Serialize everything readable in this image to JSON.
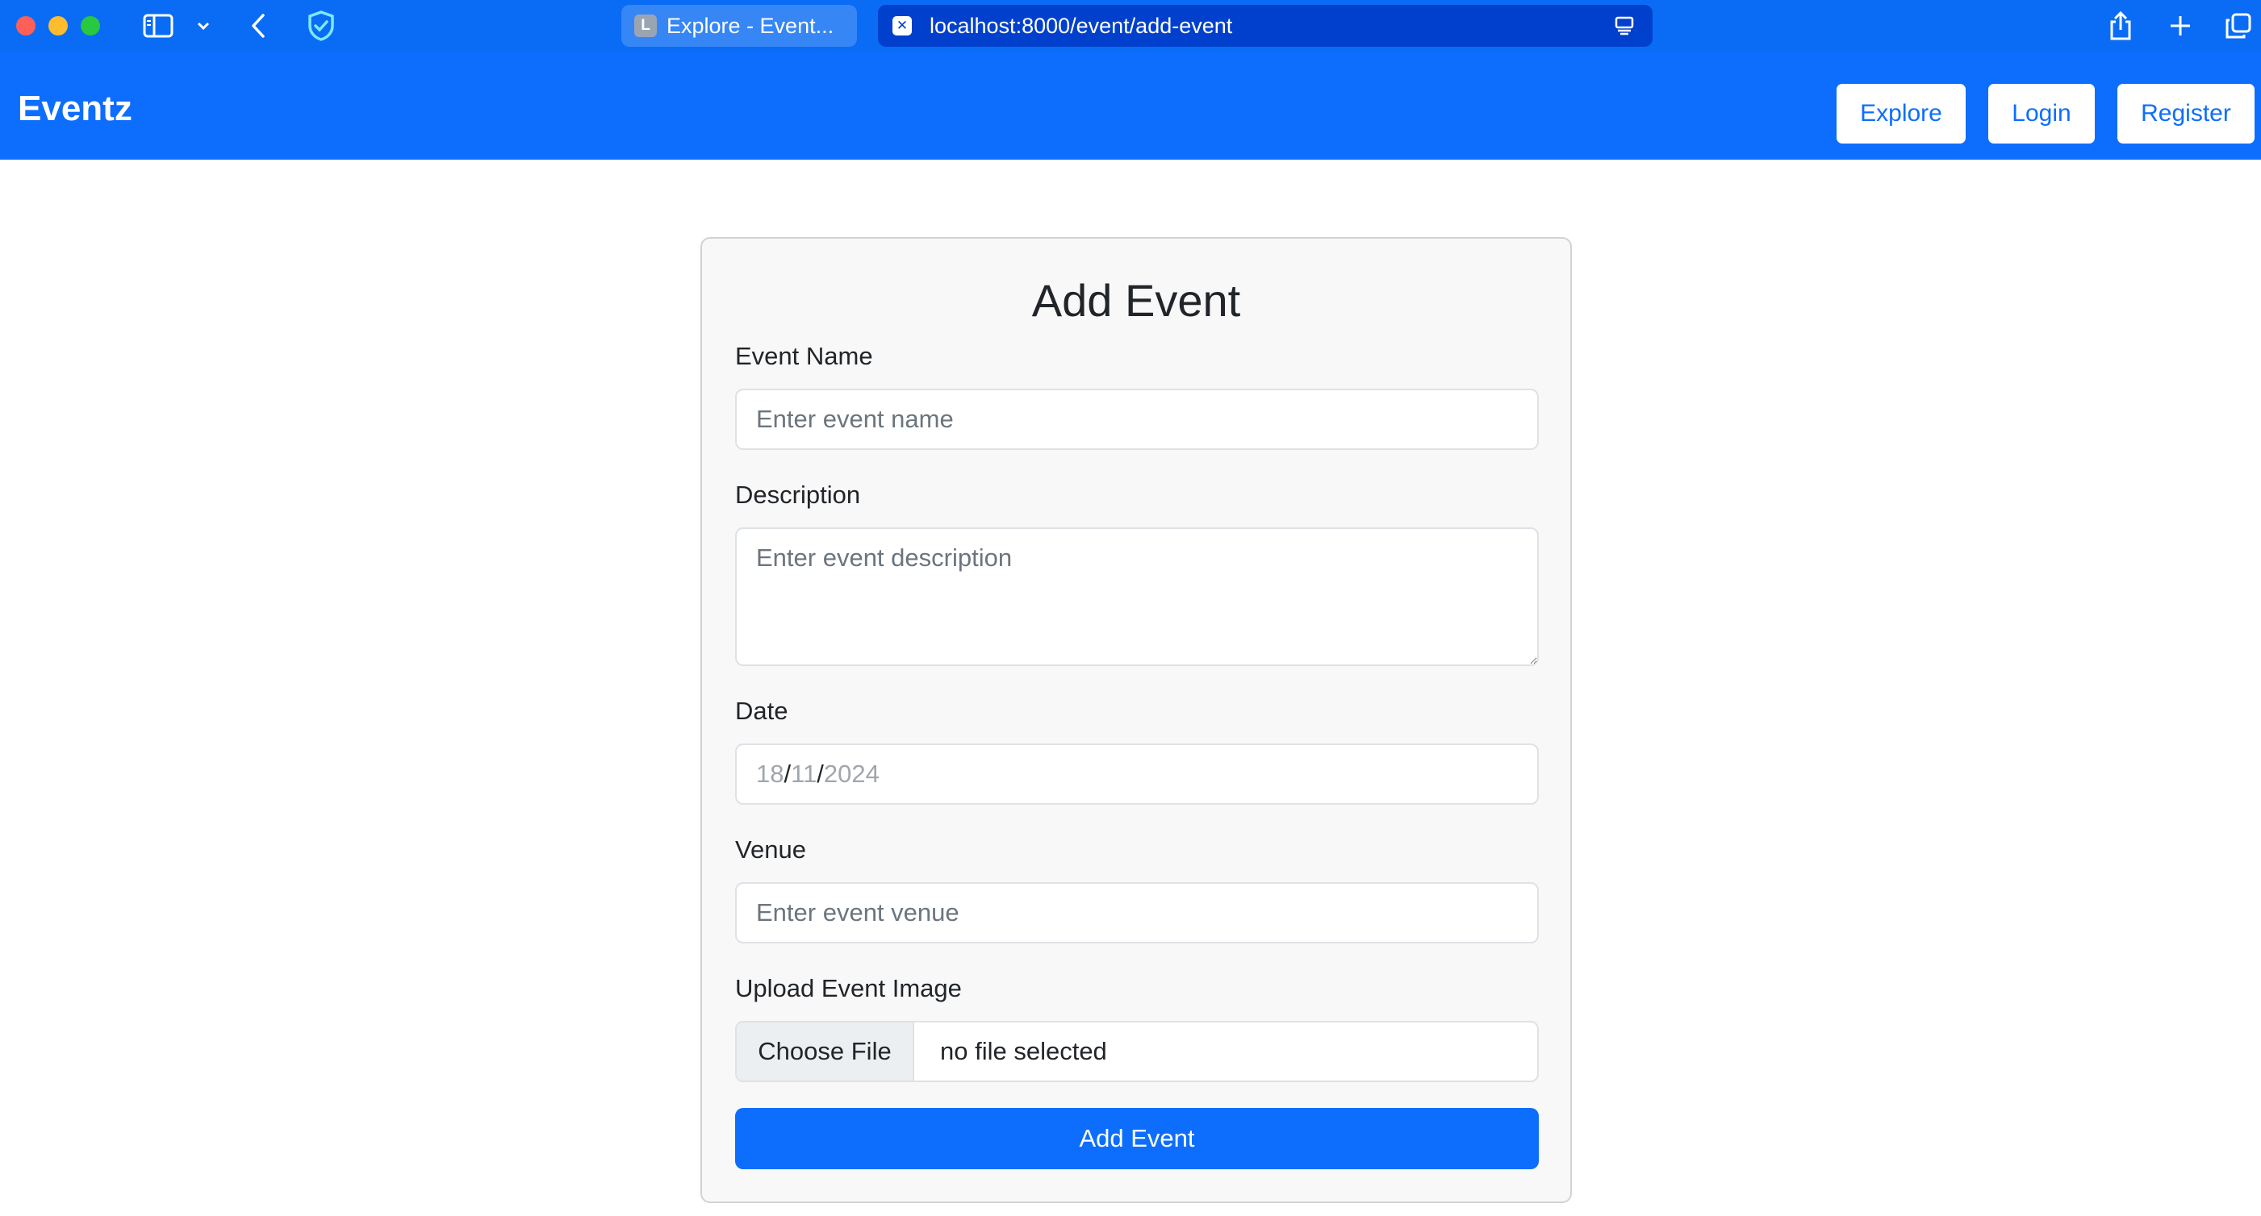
{
  "browser": {
    "tabs": [
      {
        "favicon": "L",
        "title": "Explore - Event..."
      }
    ],
    "url": "localhost:8000/event/add-event",
    "icons": [
      "sidebar-icon",
      "chevron-down-icon",
      "back-icon",
      "shield-icon",
      "reader-icon",
      "share-icon",
      "plus-icon",
      "tabs-overview-icon"
    ]
  },
  "navbar": {
    "brand": "Eventz",
    "links": [
      "Explore",
      "Login",
      "Register"
    ]
  },
  "form": {
    "title": "Add Event",
    "event_name": {
      "label": "Event Name",
      "placeholder": "Enter event name",
      "value": ""
    },
    "description": {
      "label": "Description",
      "placeholder": "Enter event description",
      "value": ""
    },
    "date": {
      "label": "Date",
      "day": "18",
      "month": "11",
      "year": "2024",
      "separator": "/"
    },
    "venue": {
      "label": "Venue",
      "placeholder": "Enter event venue",
      "value": ""
    },
    "image": {
      "label": "Upload Event Image",
      "button": "Choose File",
      "status": "no file selected"
    },
    "submit": "Add Event"
  },
  "colors": {
    "chrome": "#0a6cf5",
    "navbar": "#0d6efd",
    "primary": "#0d6efd",
    "card_bg": "#f8f8f8"
  }
}
